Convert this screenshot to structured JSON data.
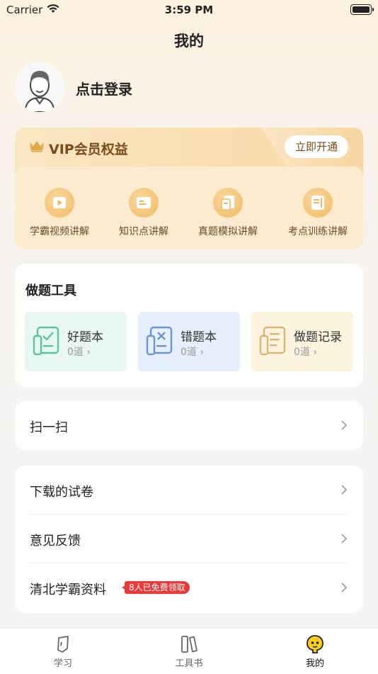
{
  "status_bar": {
    "carrier": "Carrier",
    "time": "3:59 PM"
  },
  "page_title": "我的",
  "profile": {
    "login_text": "点击登录"
  },
  "vip": {
    "title": "VIP会员权益",
    "open_button": "立即开通",
    "benefits": [
      {
        "label": "学霸视频讲解",
        "icon": "video-play-icon"
      },
      {
        "label": "知识点讲解",
        "icon": "card-icon"
      },
      {
        "label": "真题模拟讲解",
        "icon": "document-icon"
      },
      {
        "label": "考点训练讲解",
        "icon": "notebook-icon"
      }
    ]
  },
  "tools": {
    "heading": "做题工具",
    "items": [
      {
        "title": "好题本",
        "count": "0道",
        "icon": "check-notebook-icon",
        "bg": "#e8f8f1",
        "accent": "#5cc49a"
      },
      {
        "title": "错题本",
        "count": "0道",
        "icon": "wrong-notebook-icon",
        "bg": "#e6f0fd",
        "accent": "#6f95d0"
      },
      {
        "title": "做题记录",
        "count": "0道",
        "icon": "record-notebook-icon",
        "bg": "#fdf4df",
        "accent": "#d9b678"
      }
    ]
  },
  "scan": {
    "label": "扫一扫"
  },
  "menu": {
    "items": [
      {
        "label": "下载的试卷"
      },
      {
        "label": "意见反馈"
      },
      {
        "label": "清北学霸资料",
        "badge": "8人已免费领取"
      }
    ]
  },
  "tabbar": {
    "tabs": [
      {
        "label": "学习",
        "icon": "study-icon"
      },
      {
        "label": "工具书",
        "icon": "books-icon"
      },
      {
        "label": "我的",
        "icon": "mine-face-icon",
        "active": true
      }
    ]
  }
}
